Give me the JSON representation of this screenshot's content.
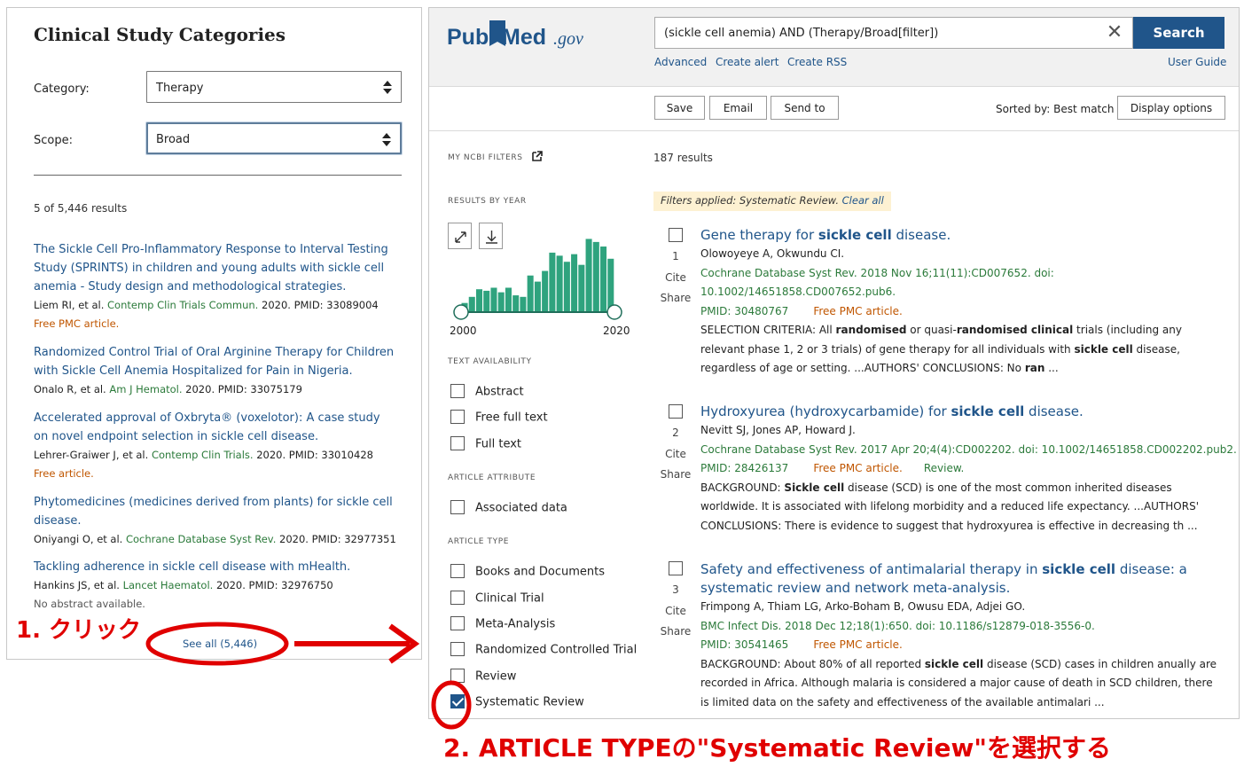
{
  "left": {
    "title": "Clinical Study Categories",
    "category_label": "Category:",
    "category_value": "Therapy",
    "scope_label": "Scope:",
    "scope_value": "Broad",
    "results_count": "5 of 5,446 results",
    "items": [
      {
        "title": "The Sickle Cell Pro-Inflammatory Response to Interval Testing Study (SPRINTS) in children and young adults with sickle cell anemia - Study design and methodological strategies.",
        "authors": "Liem RI, et al.",
        "journal": "Contemp Clin Trials Commun.",
        "rest": " 2020. PMID: 33089004",
        "tag": "Free PMC article."
      },
      {
        "title": "Randomized Control Trial of Oral Arginine Therapy for Children with Sickle Cell Anemia Hospitalized for Pain in Nigeria.",
        "authors": "Onalo R, et al.",
        "journal": "Am J Hematol.",
        "rest": " 2020. PMID: 33075179",
        "tag": ""
      },
      {
        "title": "Accelerated approval of Oxbryta® (voxelotor): A case study on novel endpoint selection in sickle cell disease.",
        "authors": "Lehrer-Graiwer J, et al.",
        "journal": "Contemp Clin Trials.",
        "rest": " 2020. PMID: 33010428",
        "tag": "Free article."
      },
      {
        "title": "Phytomedicines (medicines derived from plants) for sickle cell disease.",
        "authors": "Oniyangi O, et al.",
        "journal": "Cochrane Database Syst Rev.",
        "rest": " 2020. PMID: 32977351",
        "tag": ""
      },
      {
        "title": "Tackling adherence in sickle cell disease with mHealth.",
        "authors": "Hankins JS, et al.",
        "journal": "Lancet Haematol.",
        "rest": " 2020. PMID: 32976750",
        "tag": "No abstract available."
      }
    ],
    "see_all": "See all (5,446)"
  },
  "pubmed": {
    "logo_pub": "Pub",
    "logo_med": "Med",
    "logo_gov": ".gov",
    "query": "(sickle cell anemia) AND (Therapy/Broad[filter])",
    "clear_symbol": "✕",
    "search_label": "Search",
    "links": {
      "advanced": "Advanced",
      "create_alert": "Create alert",
      "create_rss": "Create RSS",
      "user_guide": "User Guide"
    },
    "toolbar": {
      "save": "Save",
      "email": "Email",
      "send_to": "Send to",
      "sorted_by": "Sorted by: Best match",
      "display_options": "Display options"
    },
    "filters": {
      "my_ncbi": "MY NCBI FILTERS",
      "results_by_year": "RESULTS BY YEAR",
      "year_start": "2000",
      "year_end": "2020",
      "text_availability": "TEXT AVAILABILITY",
      "text_options": [
        "Abstract",
        "Free full text",
        "Full text"
      ],
      "article_attribute": "ARTICLE ATTRIBUTE",
      "attribute_options": [
        "Associated data"
      ],
      "article_type": "ARTICLE TYPE",
      "type_options": [
        "Books and Documents",
        "Clinical Trial",
        "Meta-Analysis",
        "Randomized Controlled Trial",
        "Review",
        "Systematic Review"
      ],
      "checked": "Systematic Review"
    },
    "results_count": "187 results",
    "filters_applied_text": "Filters applied: Systematic Review.",
    "clear_all": "Clear all",
    "cite_label": "Cite",
    "share_label": "Share",
    "results": [
      {
        "num": "1",
        "title_html": "Gene therapy for <b>sickle cell</b> disease.",
        "authors": "Olowoyeye A, Okwundu CI.",
        "citation_1": "Cochrane Database Syst Rev. 2018 Nov 16;11(11):CD007652. doi:",
        "citation_2": "10.1002/14651858.CD007652.pub6.",
        "pmid": "PMID: 30480767",
        "free": "Free PMC article.",
        "review": "",
        "snippet_html": "SELECTION CRITERIA: All <b>randomised</b> or quasi-<b>randomised clinical</b> trials (including any relevant phase 1, 2 or 3 trials) of gene therapy for all individuals with <b>sickle cell</b> disease, regardless of age or setting. ...AUTHORS' CONCLUSIONS: No <b>ran</b> ..."
      },
      {
        "num": "2",
        "title_html": "Hydroxyurea (hydroxycarbamide) for <b>sickle cell</b> disease.",
        "authors": "Nevitt SJ, Jones AP, Howard J.",
        "citation_1": "Cochrane Database Syst Rev. 2017 Apr 20;4(4):CD002202. doi: 10.1002/14651858.CD002202.pub2.",
        "citation_2": "",
        "pmid": "PMID: 28426137",
        "free": "Free PMC article.",
        "review": "Review.",
        "snippet_html": "BACKGROUND: <b>Sickle cell</b> disease (SCD) is one of the most common inherited diseases worldwide. It is associated with lifelong morbidity and a reduced life expectancy. ...AUTHORS' CONCLUSIONS: There is evidence to suggest that hydroxyurea is effective in decreasing th ..."
      },
      {
        "num": "3",
        "title_html": "Safety and effectiveness of antimalarial therapy in <b>sickle cell</b> disease: a systematic review and network meta-analysis.",
        "authors": "Frimpong A, Thiam LG, Arko-Boham B, Owusu EDA, Adjei GO.",
        "citation_1": "BMC Infect Dis. 2018 Dec 12;18(1):650. doi: 10.1186/s12879-018-3556-0.",
        "citation_2": "",
        "pmid": "PMID: 30541465",
        "free": "Free PMC article.",
        "review": "",
        "snippet_html": "BACKGROUND: About 80% of all reported <b>sickle cell</b> disease (SCD) cases in children anually are recorded in Africa. Although malaria is considered a major cause of death in SCD children, there is limited data on the safety and effectiveness of the available antimalari ..."
      }
    ]
  },
  "chart_data": {
    "type": "bar",
    "x_range": [
      2000,
      2020
    ],
    "values": [
      0.12,
      0.2,
      0.3,
      0.28,
      0.32,
      0.26,
      0.32,
      0.22,
      0.2,
      0.48,
      0.4,
      0.54,
      0.78,
      0.74,
      0.66,
      0.76,
      0.62,
      0.96,
      0.92,
      0.86,
      0.7
    ],
    "range_handles": [
      "2000",
      "2020"
    ],
    "bar_color": "#2fa37e"
  },
  "annotations": {
    "step1": "1. クリック",
    "step2": "2. ARTICLE TYPEの\"Systematic Review\"を選択する",
    "color": "#e00000"
  }
}
